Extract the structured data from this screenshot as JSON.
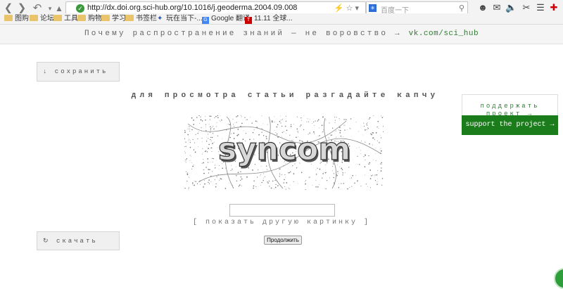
{
  "browser": {
    "url": "http://dx.doi.org.sci-hub.org/10.1016/j.geoderma.2004.09.008",
    "search_placeholder": "百度一下",
    "search_engine_label": "✳"
  },
  "bookmarks": [
    {
      "label": "图购",
      "icon": "folder-icon"
    },
    {
      "label": "论坛",
      "icon": "folder-icon"
    },
    {
      "label": "工具",
      "icon": "folder-icon"
    },
    {
      "label": "购物",
      "icon": "folder-icon"
    },
    {
      "label": "学习",
      "icon": "folder-icon"
    },
    {
      "label": "书签栏",
      "icon": "folder-icon"
    },
    {
      "label": "玩在当下-...",
      "icon": "web-icon"
    },
    {
      "label": "Google 翻译",
      "icon": "google-icon"
    },
    {
      "label": "11.11 全球...",
      "icon": "tmall-icon"
    }
  ],
  "banner": {
    "text": "Почему распространение знаний — не воровство →",
    "link": "vk.com/sci_hub"
  },
  "page": {
    "save_label": "↓ сохранить",
    "download_label": "↻ скачать",
    "title": "для просмотра статьи разгадайте капчу",
    "captcha_text": "syncom",
    "another_picture": "[ показать другую картинку ]",
    "continue_label": "Продолжить",
    "support_ru": "поддержать проект →",
    "support_en": "support the project →"
  }
}
